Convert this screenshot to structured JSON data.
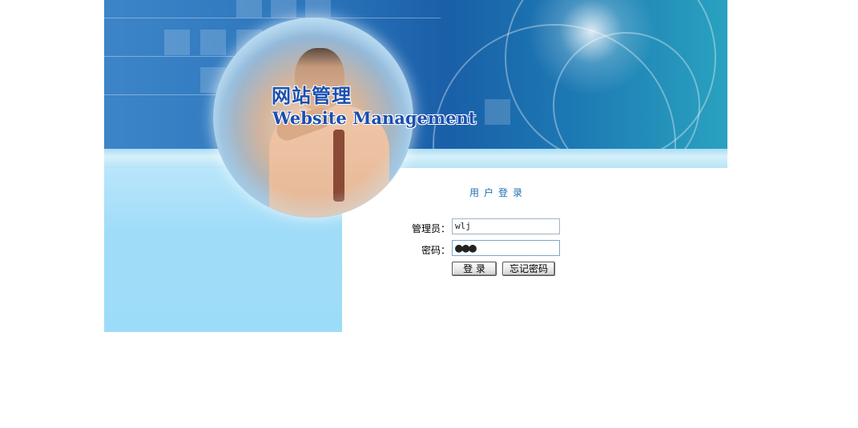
{
  "brand": {
    "title_cn": "网站管理",
    "title_en": "Website Management"
  },
  "login": {
    "title": "用户登录",
    "username_label": "管理员：",
    "username_value": "wlj",
    "password_label": "密码：",
    "password_value": "●●●",
    "login_button": "登 录",
    "forgot_button": "忘记密码"
  },
  "colors": {
    "brand_text": "#1b4fb0",
    "login_title": "#1d6fb4",
    "panel": "#9ddcf9"
  }
}
